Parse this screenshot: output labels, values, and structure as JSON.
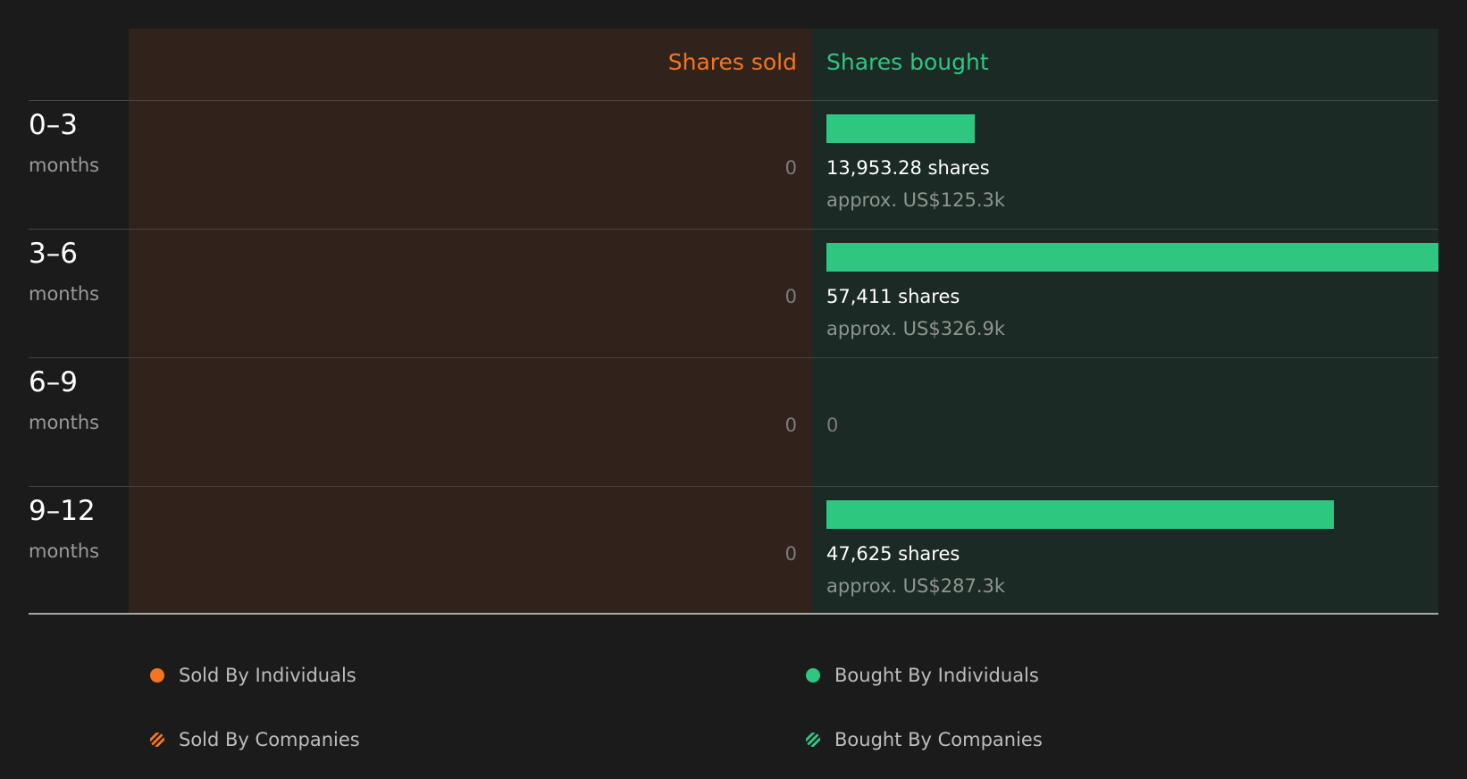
{
  "colors": {
    "background": "#1b1b1b",
    "sold_panel": "#31231b",
    "bought_panel": "#1b2a24",
    "sold_accent": "#f47521",
    "bought_accent": "#2ec780",
    "zero_text": "#7c7c7c",
    "divider": "#444444",
    "baseline": "#a8a8a8"
  },
  "chart_data": {
    "type": "bar",
    "layout": "diverging",
    "sold_header": "Shares sold",
    "bought_header": "Shares bought",
    "value_max": 57411,
    "rows": [
      {
        "range": "0–3",
        "unit": "months",
        "sold_label": "0",
        "sold": 0,
        "bought": 13953.28,
        "bought_label": "13,953.28 shares",
        "bought_value_label": "approx. US$125.3k"
      },
      {
        "range": "3–6",
        "unit": "months",
        "sold_label": "0",
        "sold": 0,
        "bought": 57411,
        "bought_label": "57,411 shares",
        "bought_value_label": "approx. US$326.9k"
      },
      {
        "range": "6–9",
        "unit": "months",
        "sold_label": "0",
        "sold": 0,
        "bought": 0,
        "bought_label": "0",
        "bought_value_label": ""
      },
      {
        "range": "9–12",
        "unit": "months",
        "sold_label": "0",
        "sold": 0,
        "bought": 47625,
        "bought_label": "47,625 shares",
        "bought_value_label": "approx. US$287.3k"
      }
    ]
  },
  "legend": {
    "sold_individuals": "Sold By Individuals",
    "sold_companies": "Sold By Companies",
    "bought_individuals": "Bought By Individuals",
    "bought_companies": "Bought By Companies"
  }
}
